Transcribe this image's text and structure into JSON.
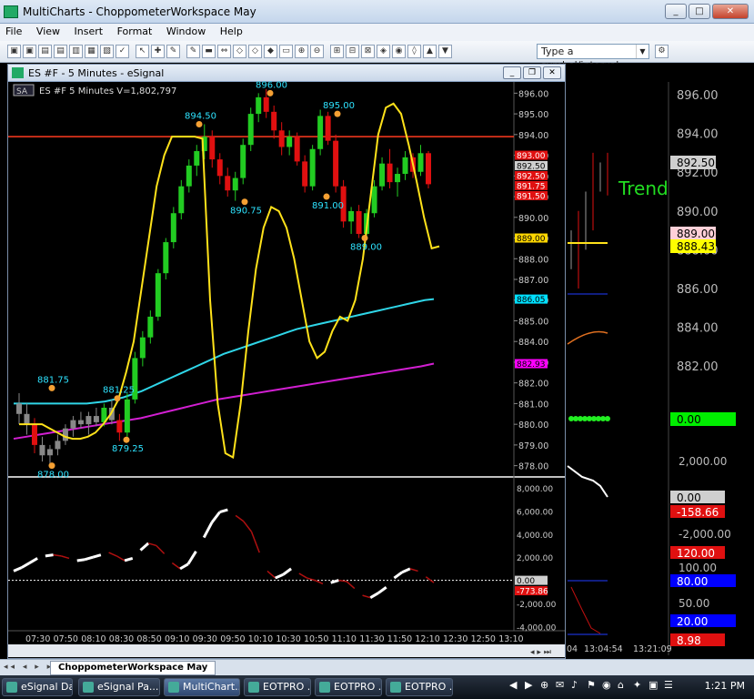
{
  "window": {
    "title": "MultiCharts - ChoppometerWorkspace May",
    "min": "_",
    "max": "□",
    "close": "✕"
  },
  "menu": [
    "File",
    "View",
    "Insert",
    "Format",
    "Window",
    "Help"
  ],
  "toolbar": {
    "symbol_placeholder": "Type a symbol/interval"
  },
  "chart_window": {
    "title": "ES #F - 5 Minutes - eSignal",
    "legend_badge": "SA",
    "legend": "ES #F  5 Minutes  V=1,802,797"
  },
  "chart_data": {
    "type": "candlestick",
    "x_ticks": [
      "07:30",
      "07:50",
      "08:10",
      "08:30",
      "08:50",
      "09:10",
      "09:30",
      "09:50",
      "10:10",
      "10:30",
      "10:50",
      "11:10",
      "11:30",
      "11:50",
      "12:10",
      "12:30",
      "12:50",
      "13:10"
    ],
    "price_axis": [
      "896.00",
      "895.00",
      "894.00",
      "893.00",
      "892.00",
      "891.00",
      "890.00",
      "889.00",
      "888.00",
      "887.00",
      "886.00",
      "885.00",
      "884.00",
      "883.00",
      "882.00",
      "881.00",
      "880.00",
      "879.00",
      "878.00"
    ],
    "ylim": [
      877.5,
      896.5
    ],
    "hline": 893.9,
    "price_tags": [
      {
        "v": 893.0,
        "label": "893.00",
        "bg": "#e01010",
        "fg": "#fff"
      },
      {
        "v": 892.5,
        "label": "892.50",
        "bg": "#cfcfcf",
        "fg": "#000"
      },
      {
        "v": 892.5,
        "label": "892.50",
        "bg": "#e01010",
        "fg": "#fff"
      },
      {
        "v": 891.75,
        "label": "891.75",
        "bg": "#e01010",
        "fg": "#fff"
      },
      {
        "v": 891.5,
        "label": "891.50",
        "bg": "#e01010",
        "fg": "#fff"
      },
      {
        "v": 889.0,
        "label": "889.00",
        "bg": "#ffd700",
        "fg": "#000"
      },
      {
        "v": 886.05,
        "label": "886.05",
        "bg": "#00e0ff",
        "fg": "#000"
      },
      {
        "v": 882.93,
        "label": "882.93",
        "bg": "#ff00ff",
        "fg": "#000"
      }
    ],
    "annotations": [
      {
        "x": 48,
        "y": 881.75,
        "text": "881.75"
      },
      {
        "x": 48,
        "y": 878.0,
        "text": "878.00"
      },
      {
        "x": 120,
        "y": 881.25,
        "text": "881.25"
      },
      {
        "x": 130,
        "y": 879.25,
        "text": "879.25"
      },
      {
        "x": 210,
        "y": 894.5,
        "text": "894.50"
      },
      {
        "x": 260,
        "y": 890.75,
        "text": "890.75"
      },
      {
        "x": 288,
        "y": 896.0,
        "text": "896.00"
      },
      {
        "x": 350,
        "y": 891.0,
        "text": "891.00"
      },
      {
        "x": 362,
        "y": 895.0,
        "text": "895.00"
      },
      {
        "x": 392,
        "y": 889.0,
        "text": "889.00"
      }
    ],
    "candles": [
      [
        881,
        881.5,
        880,
        880.5
      ],
      [
        880.5,
        881,
        879.5,
        880
      ],
      [
        880,
        880.3,
        878.6,
        879
      ],
      [
        879,
        879.4,
        878.2,
        878.5
      ],
      [
        878.5,
        879,
        878,
        878.8
      ],
      [
        878.8,
        879.5,
        878.5,
        879.2
      ],
      [
        879.2,
        880,
        879,
        879.8
      ],
      [
        879.8,
        880.4,
        879.4,
        880.2
      ],
      [
        880.2,
        880.6,
        879.8,
        880
      ],
      [
        880,
        880.6,
        879.5,
        880.4
      ],
      [
        880.4,
        880.8,
        879.9,
        880.1
      ],
      [
        880.1,
        881,
        879.9,
        880.8
      ],
      [
        880.8,
        881.2,
        880,
        880.2
      ],
      [
        880.2,
        880.5,
        879.2,
        879.6
      ],
      [
        879.6,
        881.5,
        879.4,
        881.2
      ],
      [
        881.2,
        883.5,
        881,
        883.2
      ],
      [
        883.2,
        884.5,
        882.8,
        884.2
      ],
      [
        884.2,
        885.5,
        883.9,
        885.2
      ],
      [
        885.2,
        887.5,
        885,
        887.3
      ],
      [
        887.3,
        889,
        887,
        888.8
      ],
      [
        888.8,
        890.5,
        888.5,
        890.2
      ],
      [
        890.2,
        891.8,
        889.9,
        891.5
      ],
      [
        891.5,
        892.8,
        891.2,
        892.5
      ],
      [
        892.5,
        893.5,
        892,
        893.2
      ],
      [
        893.2,
        894.5,
        892.8,
        893.9
      ],
      [
        893.9,
        894.2,
        892.4,
        892.8
      ],
      [
        892.8,
        893.1,
        891.6,
        892
      ],
      [
        892,
        892.4,
        891,
        891.3
      ],
      [
        891.3,
        892.2,
        890.8,
        891.9
      ],
      [
        891.9,
        893.8,
        891.6,
        893.5
      ],
      [
        893.5,
        895.3,
        893.2,
        895
      ],
      [
        895,
        896,
        894.6,
        895.8
      ],
      [
        895.8,
        896.2,
        894.8,
        895.1
      ],
      [
        895.1,
        895.4,
        893.8,
        894.2
      ],
      [
        894.2,
        894.6,
        893,
        893.4
      ],
      [
        893.4,
        894.2,
        893,
        893.9
      ],
      [
        893.9,
        894.1,
        892.5,
        892.7
      ],
      [
        892.7,
        893,
        891.2,
        891.5
      ],
      [
        891.5,
        893.5,
        891.3,
        893.3
      ],
      [
        893.3,
        895.2,
        893,
        894.9
      ],
      [
        894.9,
        895.1,
        893.5,
        893.7
      ],
      [
        893.7,
        894,
        891.2,
        891.5
      ],
      [
        891.5,
        891.8,
        889.5,
        889.8
      ],
      [
        889.8,
        890.5,
        889.2,
        890.3
      ],
      [
        890.3,
        890.6,
        889,
        889.2
      ],
      [
        889.2,
        890.4,
        889,
        890.2
      ],
      [
        890.2,
        891.8,
        890,
        891.5
      ],
      [
        891.5,
        892.9,
        891.3,
        892.6
      ],
      [
        892.6,
        893.3,
        891.4,
        891.7
      ],
      [
        891.7,
        892.4,
        891,
        892.1
      ],
      [
        892.1,
        893.2,
        891.8,
        892.9
      ],
      [
        892.9,
        893.1,
        891.9,
        892.2
      ],
      [
        892.2,
        893.5,
        892,
        893.1
      ],
      [
        893.1,
        893.2,
        891.4,
        891.6
      ]
    ],
    "yellow_osc": [
      880,
      880,
      880,
      880,
      879.8,
      879.6,
      879.4,
      879.3,
      879.3,
      879.4,
      879.6,
      880,
      880.5,
      881.2,
      882.5,
      884,
      886.5,
      889,
      891.5,
      893,
      893.9,
      893.9,
      893.9,
      893.9,
      893.8,
      886,
      881,
      878.6,
      878.4,
      881,
      884.5,
      887.5,
      889.5,
      890.5,
      890.3,
      889.5,
      888,
      886,
      884,
      883.2,
      883.5,
      884.5,
      885.2,
      885,
      886,
      888,
      891,
      894,
      895.3,
      895.5,
      895,
      893.5,
      891.8,
      890,
      888.5,
      888.6
    ],
    "cyan_ma": [
      881,
      881,
      881,
      881,
      881,
      881,
      881,
      881,
      881,
      881.05,
      881.1,
      881.2,
      881.3,
      881.45,
      881.6,
      881.8,
      882,
      882.2,
      882.4,
      882.6,
      882.8,
      883,
      883.2,
      883.4,
      883.55,
      883.7,
      883.85,
      884,
      884.15,
      884.3,
      884.45,
      884.6,
      884.7,
      884.8,
      884.9,
      885,
      885.1,
      885.2,
      885.3,
      885.4,
      885.5,
      885.6,
      885.7,
      885.8,
      885.9,
      886,
      886.05
    ],
    "magenta_ma": [
      879.3,
      879.4,
      879.5,
      879.6,
      879.7,
      879.8,
      879.9,
      880,
      880.1,
      880.2,
      880.3,
      880.45,
      880.6,
      880.75,
      880.9,
      881.05,
      881.2,
      881.3,
      881.4,
      881.5,
      881.6,
      881.7,
      881.8,
      881.9,
      882,
      882.1,
      882.2,
      882.3,
      882.4,
      882.5,
      882.6,
      882.7,
      882.8,
      882.93
    ],
    "sub_axis": [
      "8,000.00",
      "6,000.00",
      "4,000.00",
      "2,000.00",
      "0.00",
      "-2,000.00",
      "-4,000.00"
    ],
    "sub_ylim": [
      -4200,
      8700
    ],
    "sub_tags": [
      {
        "v": 0,
        "label": "0.00",
        "bg": "#cfcfcf",
        "fg": "#000"
      },
      {
        "v": -900,
        "label": "-773.86",
        "bg": "#e01010",
        "fg": "#fff"
      }
    ],
    "sub_values": [
      800,
      1100,
      1500,
      1900,
      2100,
      2200,
      2100,
      1900,
      1700,
      1800,
      2000,
      2200,
      2400,
      2100,
      1700,
      1900,
      2600,
      3200,
      3000,
      2300,
      1500,
      1000,
      1400,
      2500,
      3700,
      5000,
      5900,
      6100,
      5600,
      5100,
      4200,
      2400,
      800,
      200,
      500,
      1000,
      600,
      200,
      0,
      -300,
      -200,
      0,
      -100,
      -700,
      -1300,
      -1500,
      -1100,
      -600,
      200,
      700,
      1000,
      800,
      300,
      -200
    ]
  },
  "right_panel": {
    "price_axis": [
      "896.00",
      "894.00",
      "892.00",
      "890.00",
      "888.00",
      "886.00",
      "884.00",
      "882.00"
    ],
    "label_trend": "Trend",
    "tags": [
      {
        "label": "892.50",
        "bg": "#cfcfcf",
        "fg": "#000"
      },
      {
        "label": "889.00",
        "bg": "#ffd0d8",
        "fg": "#000"
      },
      {
        "label": "888.43",
        "bg": "#ffff00",
        "fg": "#000"
      },
      {
        "label": "0.00",
        "bg": "#00ee00",
        "fg": "#000"
      }
    ],
    "sub_axis": [
      "2,000.00",
      "-2,000.00",
      "100.00",
      "50.00"
    ],
    "sub_tags": [
      {
        "label": "0.00",
        "bg": "#cfcfcf",
        "fg": "#000"
      },
      {
        "label": "-158.66",
        "bg": "#e01010",
        "fg": "#fff"
      },
      {
        "label": "120.00",
        "bg": "#e01010",
        "fg": "#fff"
      },
      {
        "label": "80.00",
        "bg": "#0000ff",
        "fg": "#fff"
      },
      {
        "label": "20.00",
        "bg": "#0000ff",
        "fg": "#fff"
      },
      {
        "label": "8.98",
        "bg": "#e01010",
        "fg": "#fff"
      }
    ],
    "times": [
      "04",
      "13:04:54",
      "13:21:09"
    ]
  },
  "workspace_tab": "ChoppometerWorkspace May",
  "taskbar": {
    "items": [
      "eSignal Da...",
      "eSignal Pa...",
      "MultiChart...",
      "EOTPRO ...",
      "EOTPRO ...",
      "EOTPRO ..."
    ],
    "clock": "1:21 PM"
  }
}
